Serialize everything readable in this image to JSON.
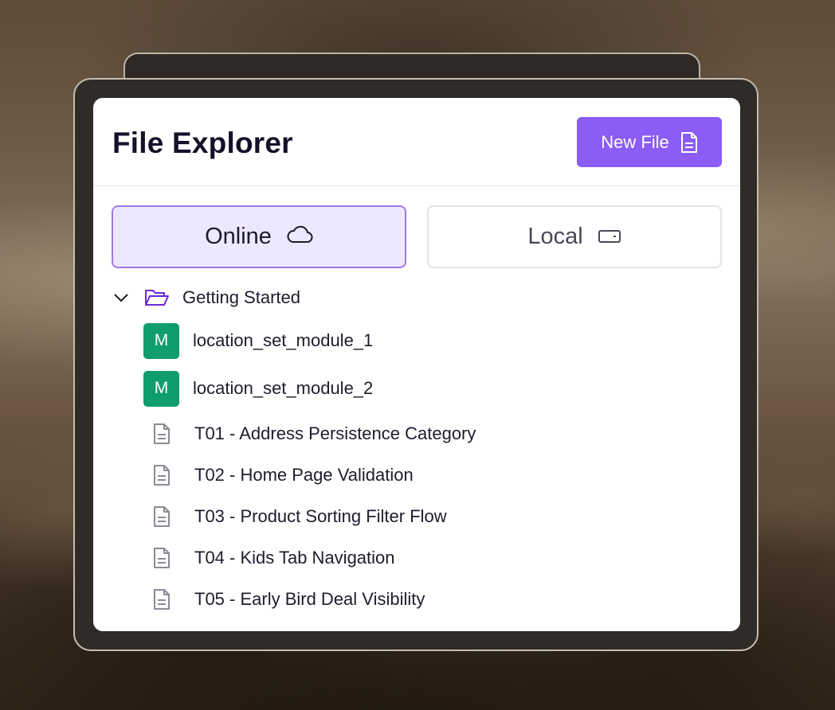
{
  "window": {
    "title": "File Explorer",
    "new_file_label": "New File",
    "accent_color": "#8b5cf6"
  },
  "tabs": [
    {
      "label": "Online",
      "icon": "cloud-icon",
      "active": true
    },
    {
      "label": "Local",
      "icon": "drive-icon",
      "active": false
    }
  ],
  "tree": {
    "folder": {
      "label": "Getting Started",
      "expanded": true
    },
    "modules": [
      {
        "badge": "M",
        "label": "location_set_module_1"
      },
      {
        "badge": "M",
        "label": "location_set_module_2"
      }
    ],
    "tests": [
      {
        "label": "T01 - Address Persistence Category"
      },
      {
        "label": "T02 - Home Page Validation"
      },
      {
        "label": "T03 - Product Sorting Filter Flow"
      },
      {
        "label": "T04 - Kids Tab Navigation"
      },
      {
        "label": "T05 - Early Bird Deal Visibility"
      }
    ]
  }
}
